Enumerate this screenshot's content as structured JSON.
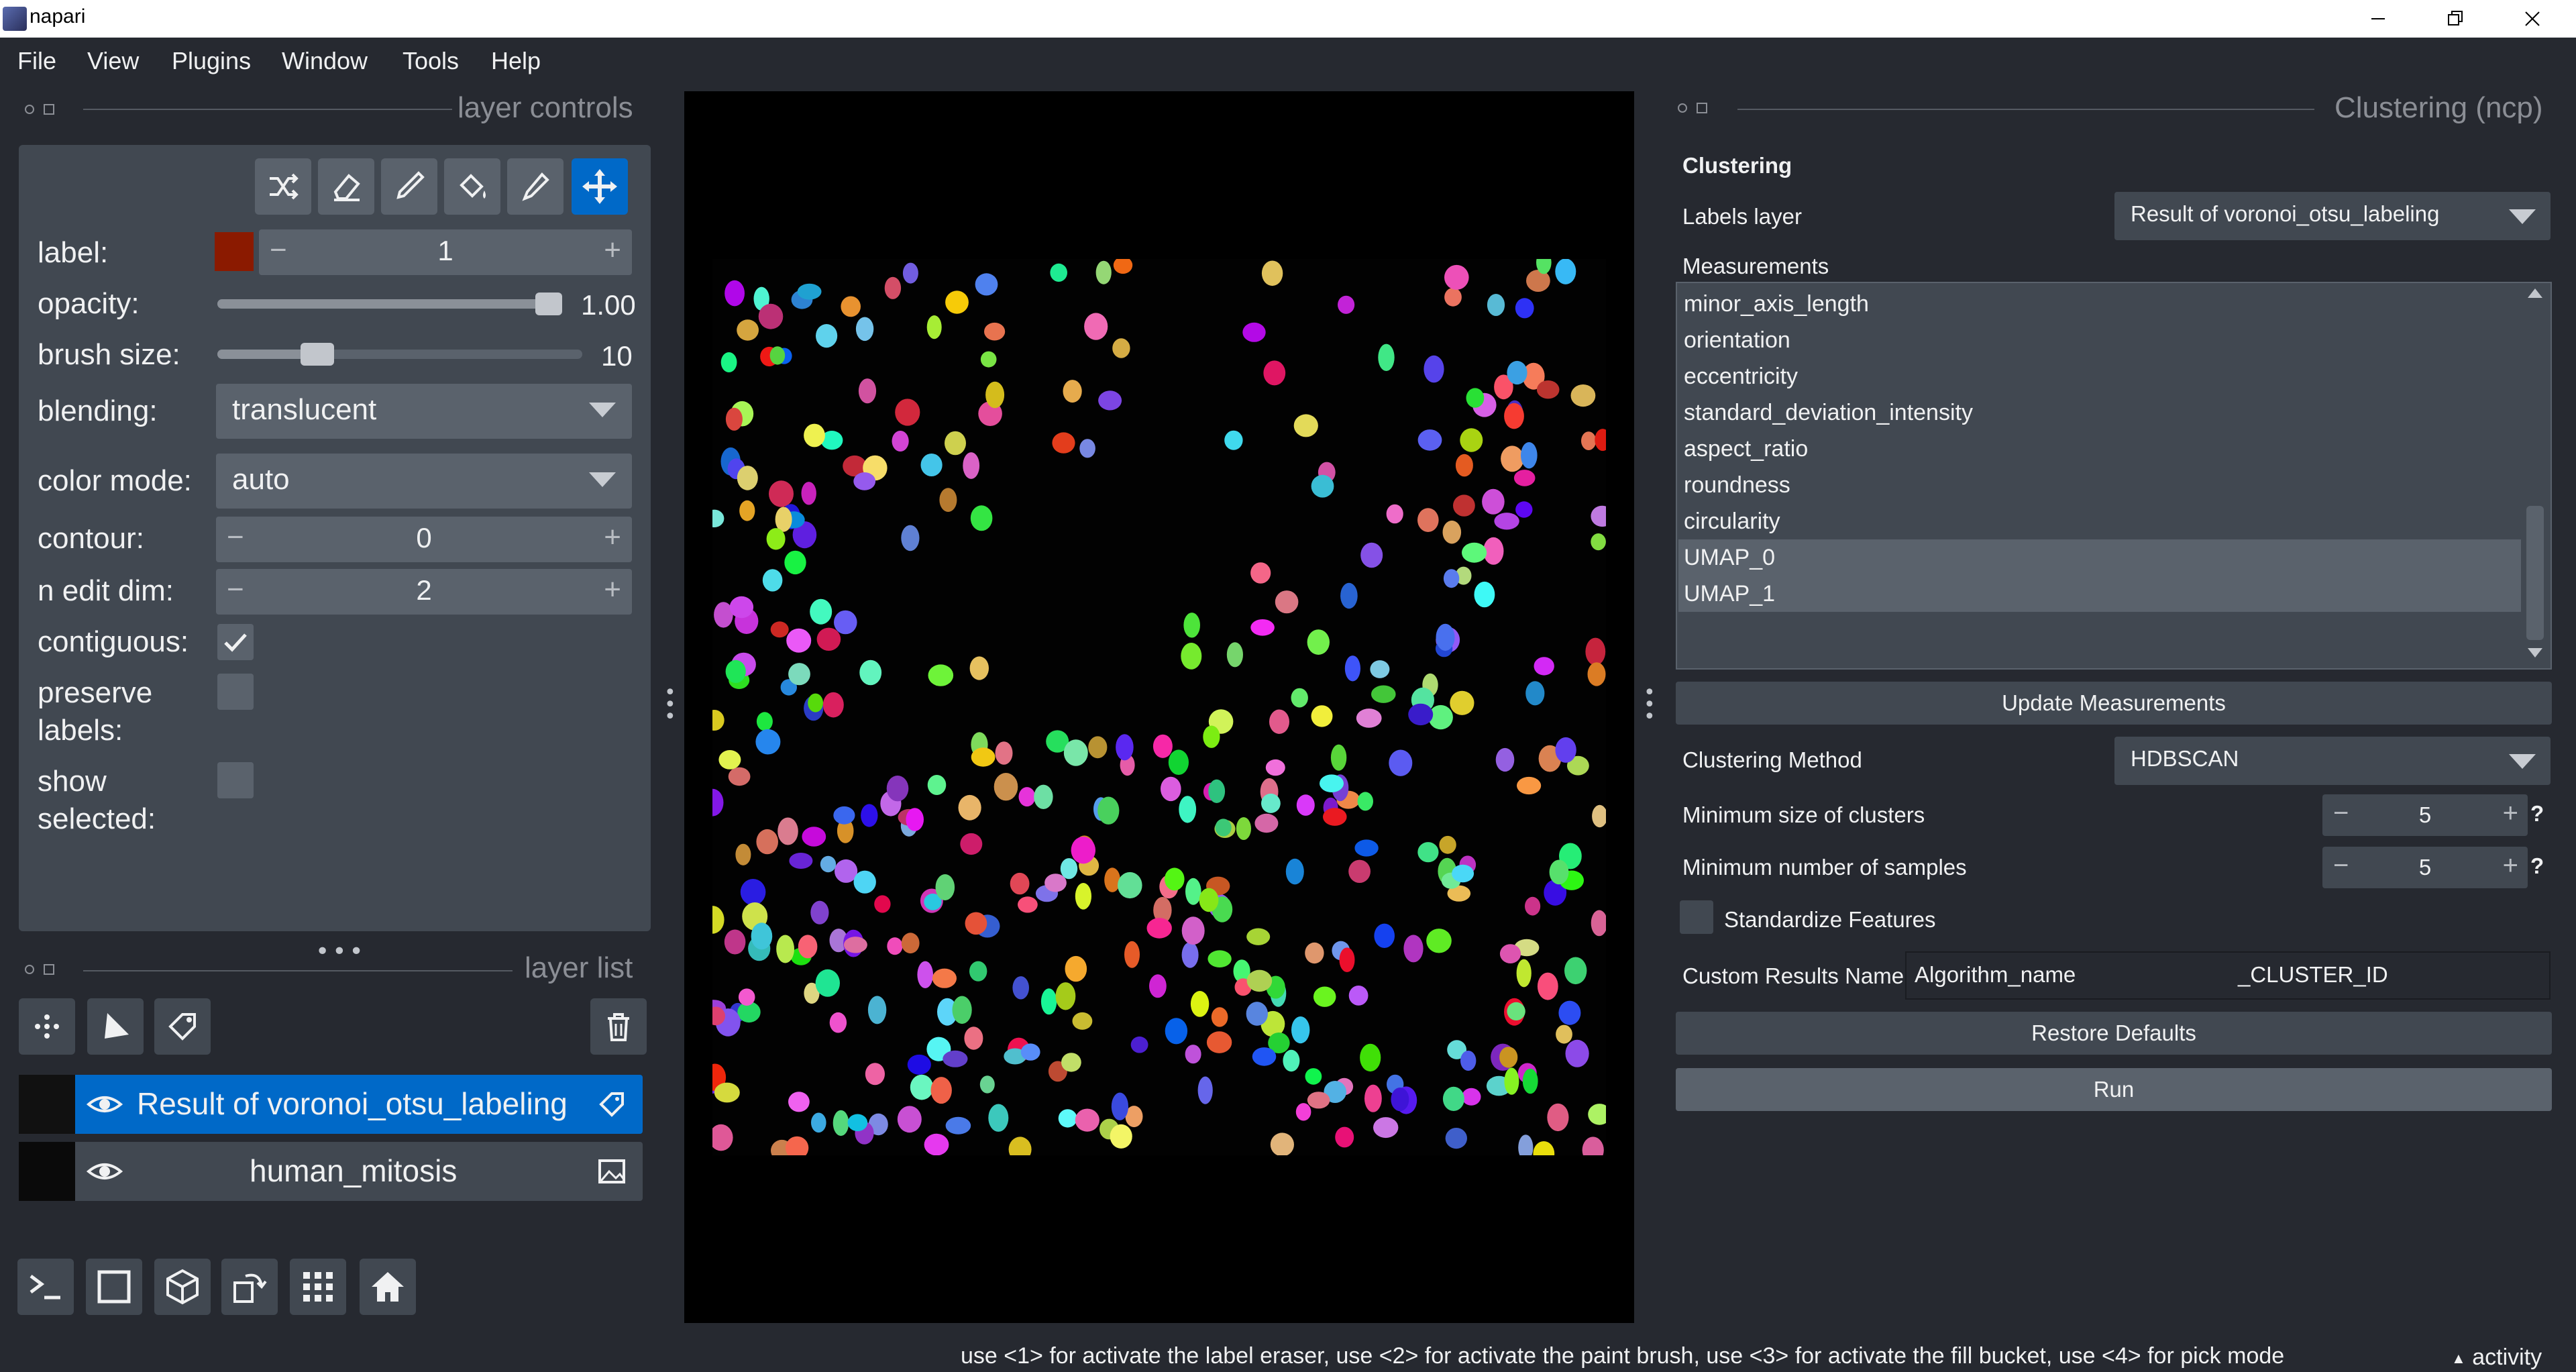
{
  "titlebar": {
    "title": "napari"
  },
  "menubar": {
    "items": [
      "File",
      "View",
      "Plugins",
      "Window",
      "Tools",
      "Help"
    ]
  },
  "layer_controls": {
    "title": "layer controls",
    "label_label": "label:",
    "label_value": "1",
    "label_color": "#8b1a00",
    "opacity_label": "opacity:",
    "opacity_value": "1.00",
    "opacity_fraction": 1.0,
    "brush_size_label": "brush size:",
    "brush_size_value": "10",
    "brush_fraction": 0.25,
    "blending_label": "blending:",
    "blending_value": "translucent",
    "color_mode_label": "color mode:",
    "color_mode_value": "auto",
    "contour_label": "contour:",
    "contour_value": "0",
    "n_edit_dim_label": "n edit dim:",
    "n_edit_dim_value": "2",
    "contiguous_label": "contiguous:",
    "contiguous_checked": true,
    "preserve_labels_label_1": "preserve",
    "preserve_labels_label_2": "labels:",
    "preserve_labels_checked": false,
    "show_selected_label_1": "show",
    "show_selected_label_2": "selected:",
    "show_selected_checked": false,
    "active_tool": "move-icon"
  },
  "layer_list": {
    "title": "layer list",
    "layers": [
      {
        "name": "Result of voronoi_otsu_labeling",
        "selected": true,
        "type_icon": "label-tag-icon"
      },
      {
        "name": "human_mitosis",
        "selected": false,
        "type_icon": "image-icon"
      }
    ]
  },
  "clustering": {
    "dock_title": "Clustering (ncp)",
    "section_title": "Clustering",
    "labels_layer_label": "Labels layer",
    "labels_layer_value": "Result of voronoi_otsu_labeling",
    "measurements_label": "Measurements",
    "measurements": [
      {
        "name": "minor_axis_length",
        "selected": false
      },
      {
        "name": "orientation",
        "selected": false
      },
      {
        "name": "eccentricity",
        "selected": false
      },
      {
        "name": "standard_deviation_intensity",
        "selected": false
      },
      {
        "name": "aspect_ratio",
        "selected": false
      },
      {
        "name": "roundness",
        "selected": false
      },
      {
        "name": "circularity",
        "selected": false
      },
      {
        "name": "UMAP_0",
        "selected": true
      },
      {
        "name": "UMAP_1",
        "selected": true
      }
    ],
    "update_button": "Update Measurements",
    "method_label": "Clustering Method",
    "method_value": "HDBSCAN",
    "min_cluster_label": "Minimum size of clusters",
    "min_cluster_value": "5",
    "min_samples_label": "Minimum number of samples",
    "min_samples_value": "5",
    "help_mark": "?",
    "standardize_label": "Standardize Features",
    "standardize_checked": false,
    "custom_name_label": "Custom Results Name",
    "custom_name_value": "Algorithm_name",
    "custom_name_suffix": "_CLUSTER_ID",
    "restore_button": "Restore Defaults",
    "run_button": "Run"
  },
  "status": {
    "message": "use <1> for activate the label eraser, use <2> for activate the paint brush, use <3> for activate the fill bucket, use <4> for pick mode",
    "activity": "activity"
  },
  "colors": {
    "accent": "#0069c8",
    "panel": "#414851",
    "background": "#262930",
    "button": "#5a626c"
  }
}
